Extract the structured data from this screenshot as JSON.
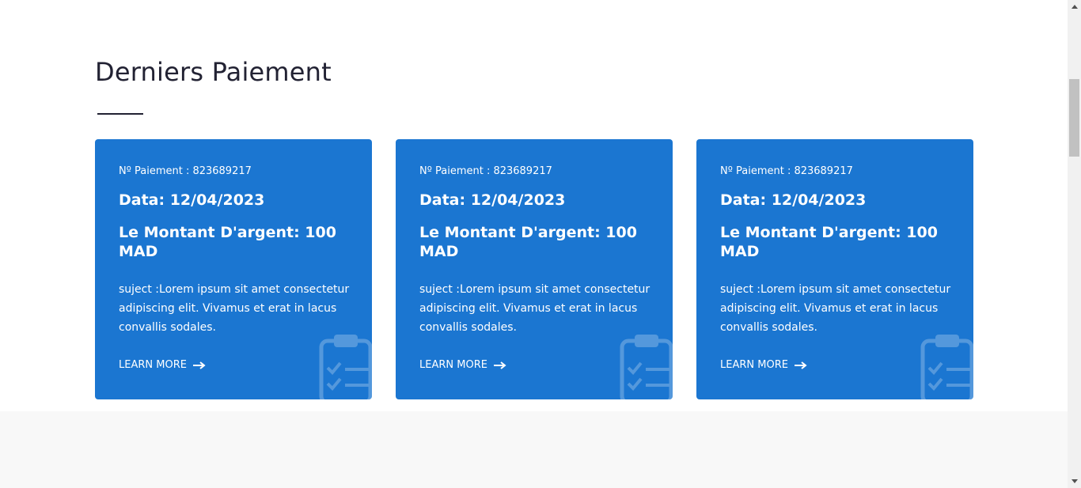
{
  "section": {
    "title": "Derniers Paiement"
  },
  "cards": [
    {
      "payment_no": "Nº Paiement : 823689217",
      "date": "Data: 12/04/2023",
      "amount": "Le Montant D'argent: 100 MAD",
      "subject": "suject :Lorem ipsum sit amet consectetur adipiscing elit. Vivamus et erat in lacus convallis sodales.",
      "link_label": "LEARN MORE"
    },
    {
      "payment_no": "Nº Paiement : 823689217",
      "date": "Data: 12/04/2023",
      "amount": "Le Montant D'argent: 100 MAD",
      "subject": "suject :Lorem ipsum sit amet consectetur adipiscing elit. Vivamus et erat in lacus convallis sodales.",
      "link_label": "LEARN MORE"
    },
    {
      "payment_no": "Nº Paiement : 823689217",
      "date": "Data: 12/04/2023",
      "amount": "Le Montant D'argent: 100 MAD",
      "subject": "suject :Lorem ipsum sit amet consectetur adipiscing elit. Vivamus et erat in lacus convallis sodales.",
      "link_label": "LEARN MORE"
    }
  ],
  "icons": {
    "card_watermark": "clipboard-checklist-icon",
    "link_arrow": "arrow-right-icon"
  },
  "colors": {
    "card_background": "#1b76d1",
    "title_text": "#222233",
    "footer_band": "#f8f8f8"
  }
}
